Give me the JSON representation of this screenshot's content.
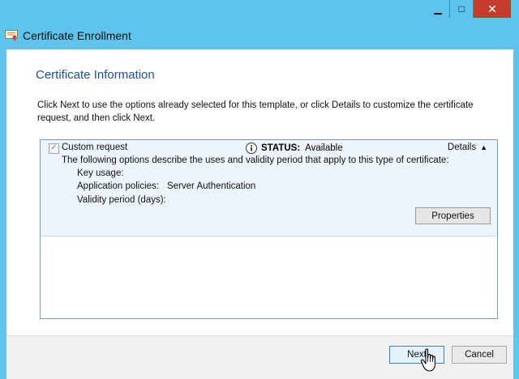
{
  "window": {
    "title": "Certificate Enrollment",
    "controls": {
      "minimize": "▁",
      "maximize": "□",
      "close": "✕"
    }
  },
  "page": {
    "heading": "Certificate Information",
    "intro": "Click Next to use the options already selected for this template, or click Details to customize the certificate request, and then click Next."
  },
  "panel": {
    "checkbox_label": "Custom request",
    "checkbox_checked": true,
    "status_label": "STATUS:",
    "status_value": "Available",
    "details_label": "Details",
    "description": "The following options describe the uses and validity period that apply to this type of certificate:",
    "key_usage_label": "Key usage:",
    "app_policies_label": "Application policies:",
    "app_policies_value": "Server Authentication",
    "validity_label": "Validity period (days):",
    "properties_button": "Properties"
  },
  "footer": {
    "next_button": "Next",
    "cancel_button": "Cancel"
  },
  "colors": {
    "window_frame": "#5ec4ec",
    "heading": "#1f4e97",
    "close_button": "#c73b2f",
    "panel_fill": "#edf4fb",
    "panel_border": "#6c9bd0"
  },
  "icons": {
    "app": "certificate-icon",
    "status": "info-icon",
    "details": "chevron-up-icon",
    "cursor": "hand-pointer-icon"
  }
}
